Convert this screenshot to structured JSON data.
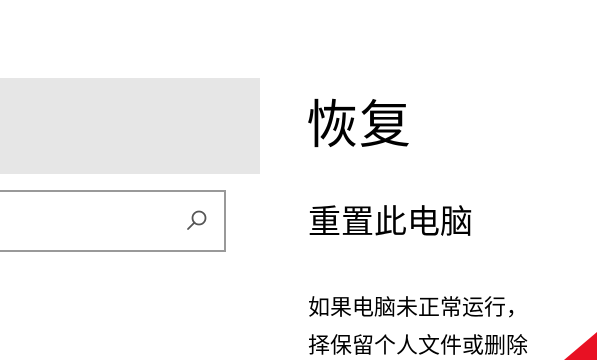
{
  "page": {
    "title": "恢复"
  },
  "sidebar": {
    "search": {
      "value": "",
      "placeholder": "",
      "icon": "search-icon"
    }
  },
  "reset_section": {
    "title": "重置此电脑",
    "description_lines": [
      "如果电脑未正常运行，",
      "择保留个人文件或删除"
    ]
  },
  "colors": {
    "background": "#ffffff",
    "home_banner": "#e6e6e6",
    "search_border": "#999999",
    "cursor": "#e81123"
  }
}
